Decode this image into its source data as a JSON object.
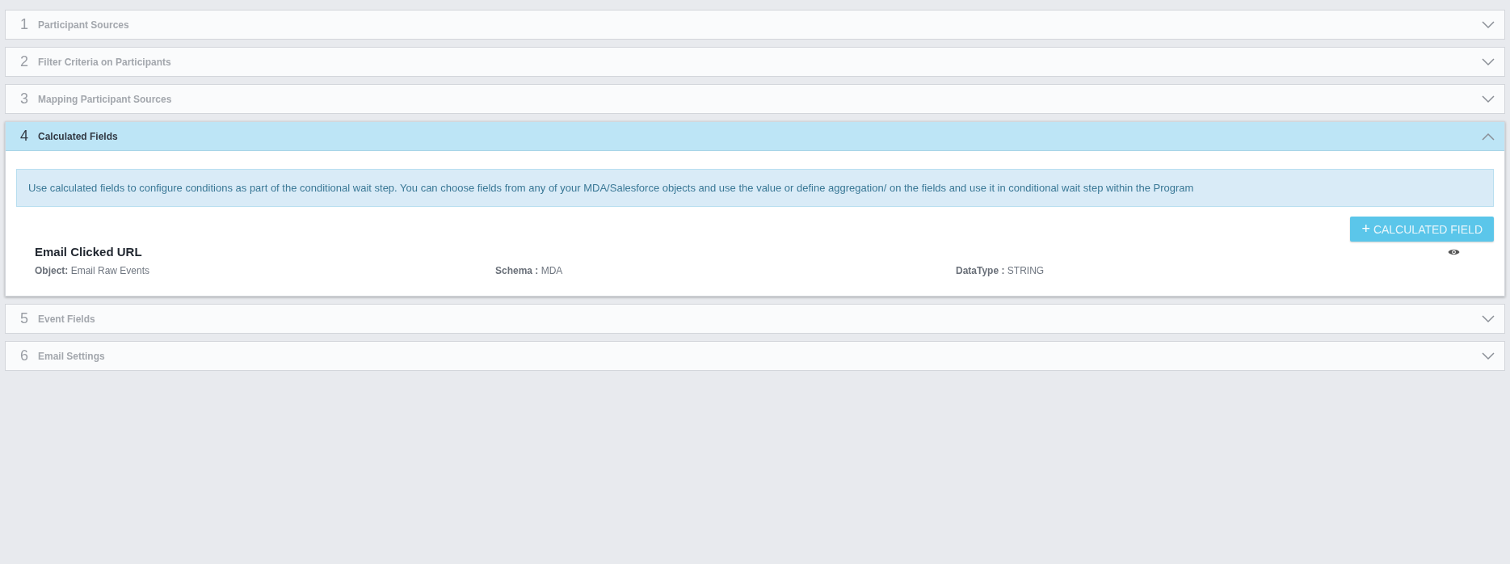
{
  "sections": [
    {
      "number": "1",
      "title": "Participant Sources",
      "expanded": false
    },
    {
      "number": "2",
      "title": "Filter Criteria on Participants",
      "expanded": false
    },
    {
      "number": "3",
      "title": "Mapping Participant Sources",
      "expanded": false
    },
    {
      "number": "4",
      "title": "Calculated Fields",
      "expanded": true,
      "info": "Use calculated fields to configure conditions as part of the conditional wait step. You can choose fields from any of your MDA/Salesforce objects and use the value or define aggregation/ on the fields and use it in conditional wait step within the Program",
      "add_button": {
        "icon": "+",
        "label": "CALCULATED FIELD"
      },
      "fields": [
        {
          "name": "Email Clicked URL",
          "properties": [
            "**Object:** Email Raw Events",
            "**Schema :** MDA",
            "**DataType :** STRING"
          ]
        }
      ]
    },
    {
      "number": "5",
      "title": "Event Fields",
      "expanded": false
    },
    {
      "number": "6",
      "title": "Email Settings",
      "expanded": false
    }
  ]
}
